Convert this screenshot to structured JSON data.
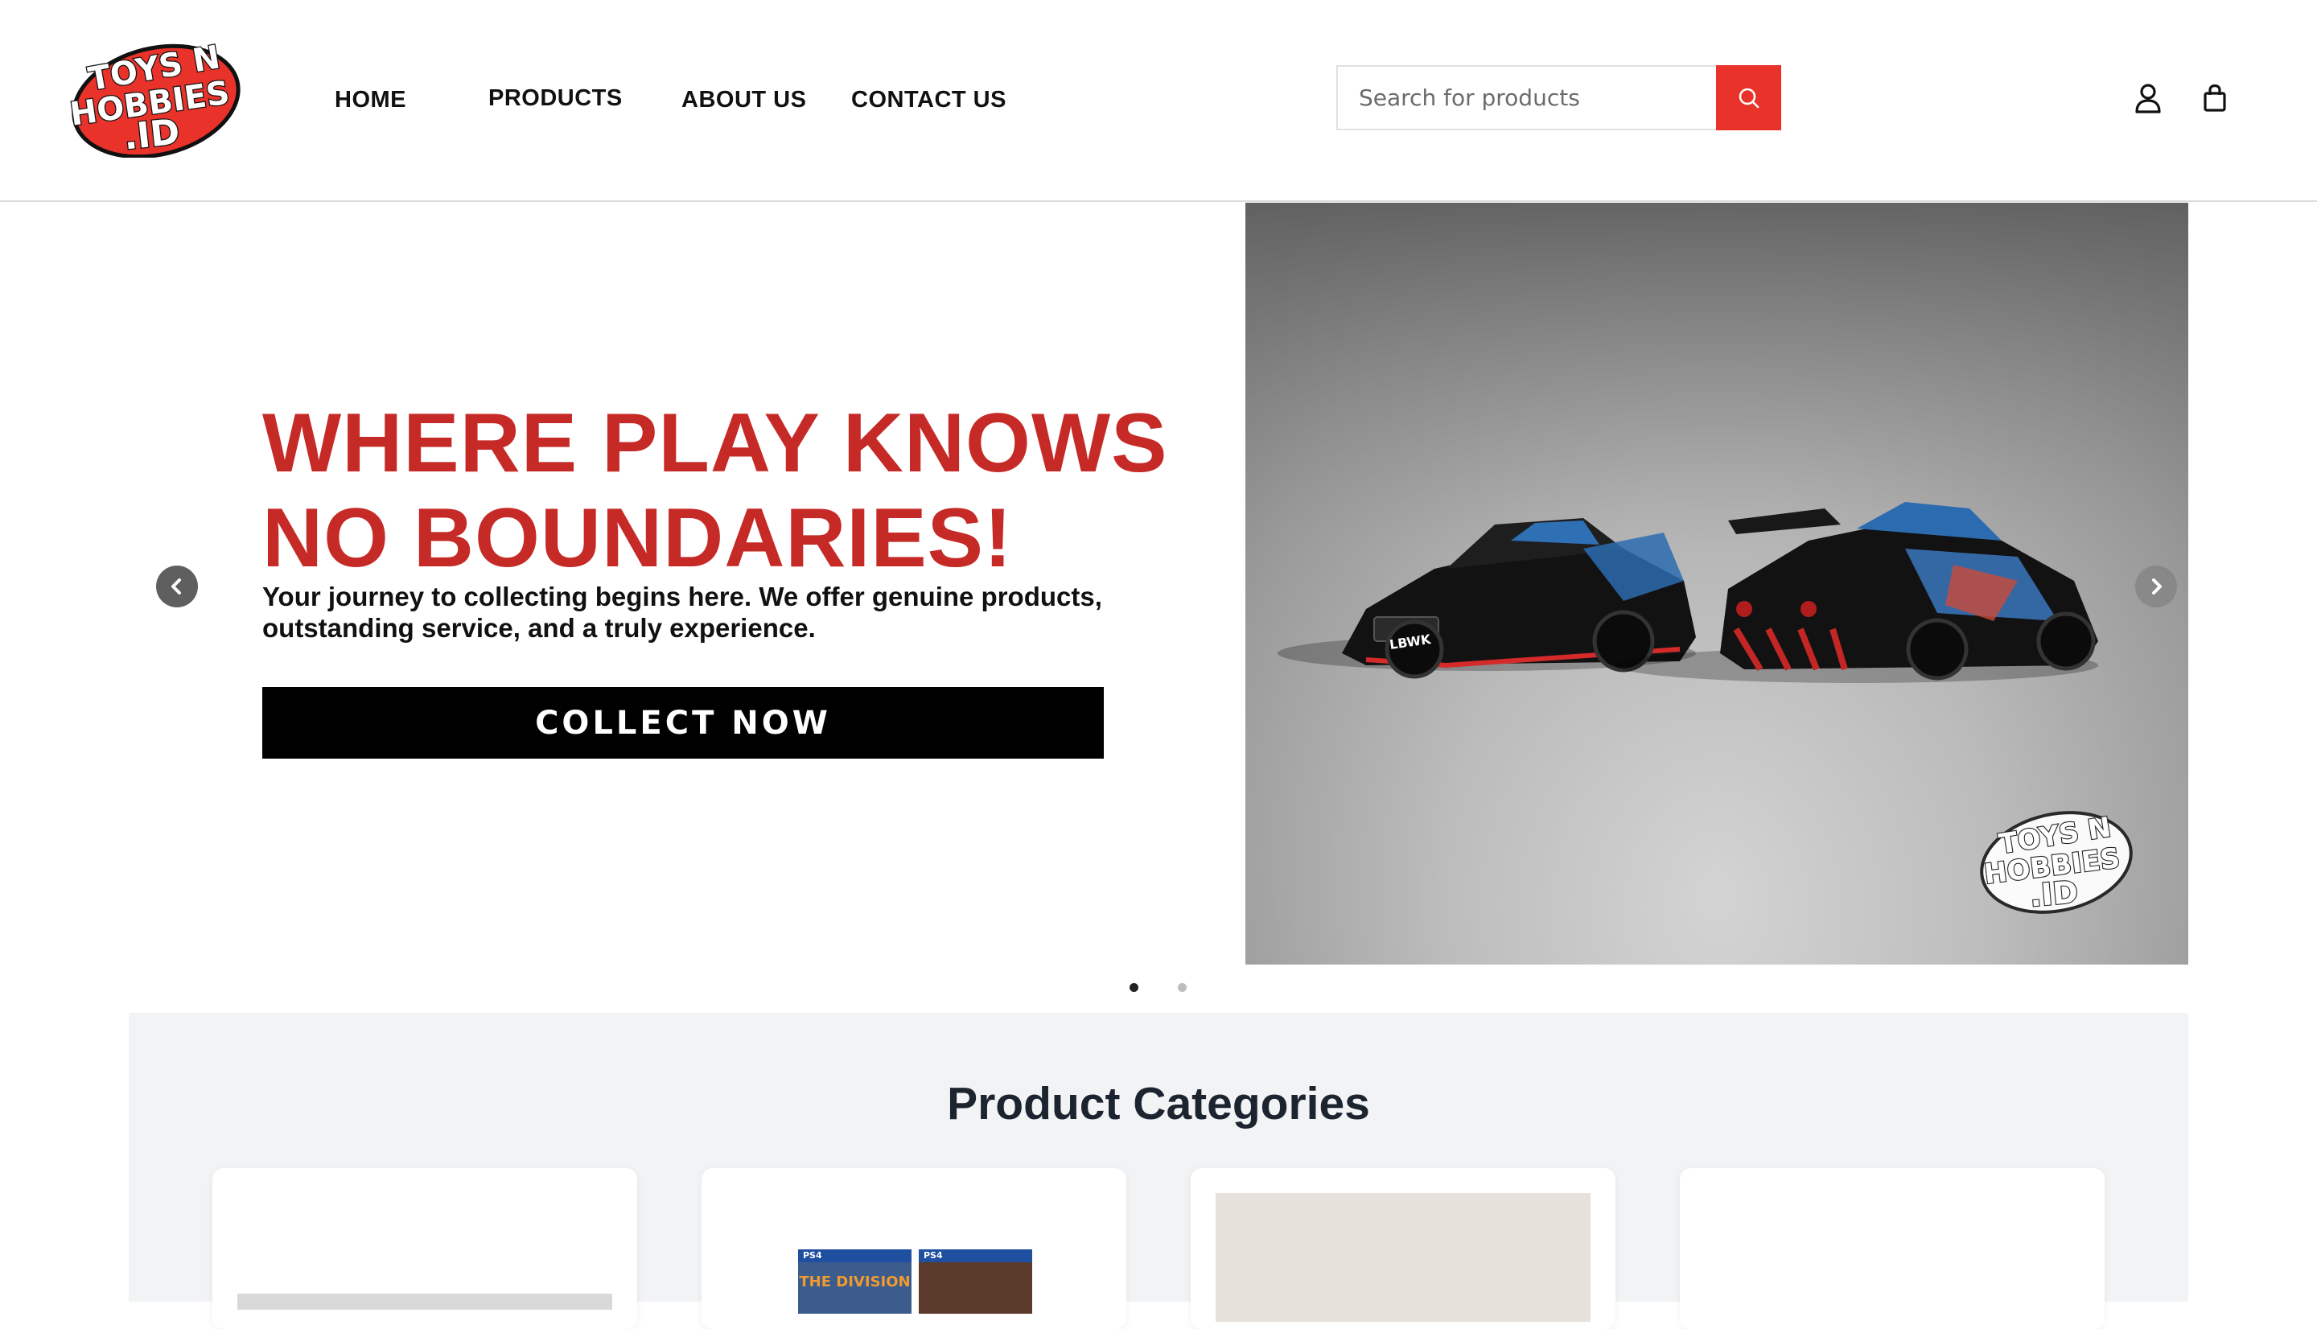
{
  "header": {
    "logo": {
      "line1": "TOYS N",
      "line2": "HOBBIES",
      "line3": ".ID"
    },
    "nav": [
      {
        "label": "HOME"
      },
      {
        "label": "PRODUCTS"
      },
      {
        "label": "ABOUT US"
      },
      {
        "label": "CONTACT US"
      }
    ],
    "search": {
      "placeholder": "Search for products",
      "value": ""
    },
    "icons": {
      "search": "search-icon",
      "account": "user-icon",
      "cart": "shopping-bag-icon"
    },
    "accent_color": "#e8322a"
  },
  "hero": {
    "title_line1": "WHERE PLAY KNOWS",
    "title_line2": "NO BOUNDARIES!",
    "subtitle_line1": "Your journey to collecting begins here. We offer genuine products,",
    "subtitle_line2": "outstanding service, and a truly experience.",
    "cta_label": "COLLECT NOW",
    "title_color": "#c62a26",
    "image_watermark": {
      "line1": "TOYS N",
      "line2": "HOBBIES",
      "line3": ".ID"
    },
    "car_plate": "LBWK",
    "slides_total": 2,
    "active_slide": 1
  },
  "categories": {
    "title": "Product Categories",
    "cards": [
      {
        "id": 1
      },
      {
        "id": 2,
        "badge_left": "PS4",
        "badge_right": "PS4",
        "game_left": "THE DIVISION"
      },
      {
        "id": 3
      },
      {
        "id": 4
      }
    ]
  }
}
